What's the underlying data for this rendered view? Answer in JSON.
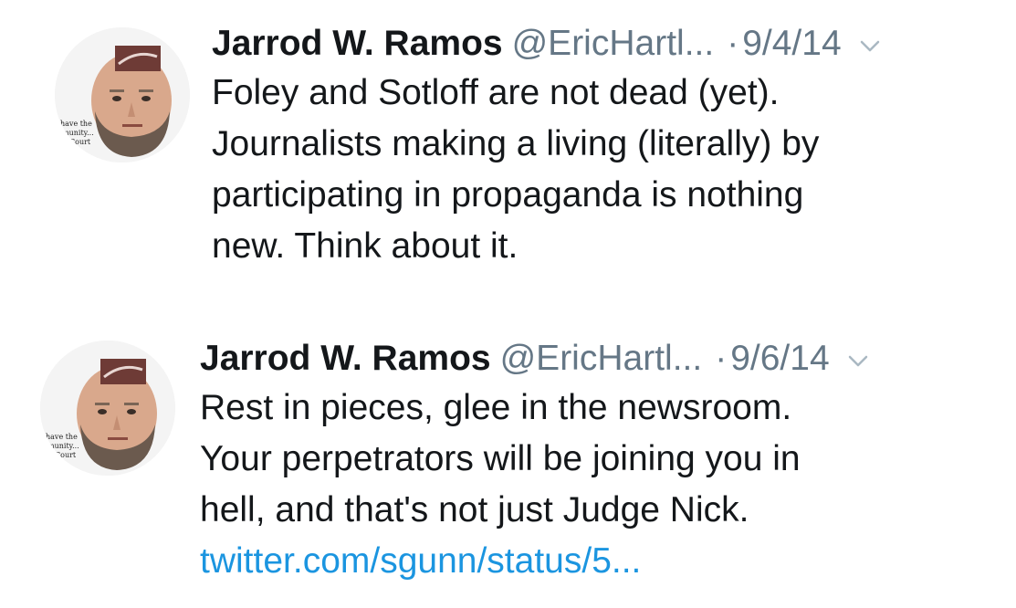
{
  "tweets": [
    {
      "author_name": "Jarrod W. Ramos",
      "handle": "@EricHartl...",
      "separator": "·",
      "date": "9/4/14",
      "text_lines": [
        "Foley and Sotloff are not dead (yet).",
        "Journalists making a living (literally) by",
        "participating in propaganda is nothing",
        "new. Think about it."
      ],
      "link": ""
    },
    {
      "author_name": "Jarrod W. Ramos",
      "handle": "@EricHartl...",
      "separator": "·",
      "date": "9/6/14",
      "text_lines": [
        "Rest in pieces, glee in the newsroom.",
        "Your perpetrators will be joining you in",
        "hell, and that's not just Judge Nick."
      ],
      "link": "twitter.com/sgunn/status/5..."
    }
  ],
  "avatar_caption_lines": [
    "have the",
    "munity...",
    "Court"
  ],
  "colors": {
    "name": "#14171a",
    "secondary": "#657786",
    "link": "#1b95e0",
    "background": "#ffffff"
  },
  "icons": {
    "caret": "chevron-down-icon",
    "avatar": "avatar"
  }
}
